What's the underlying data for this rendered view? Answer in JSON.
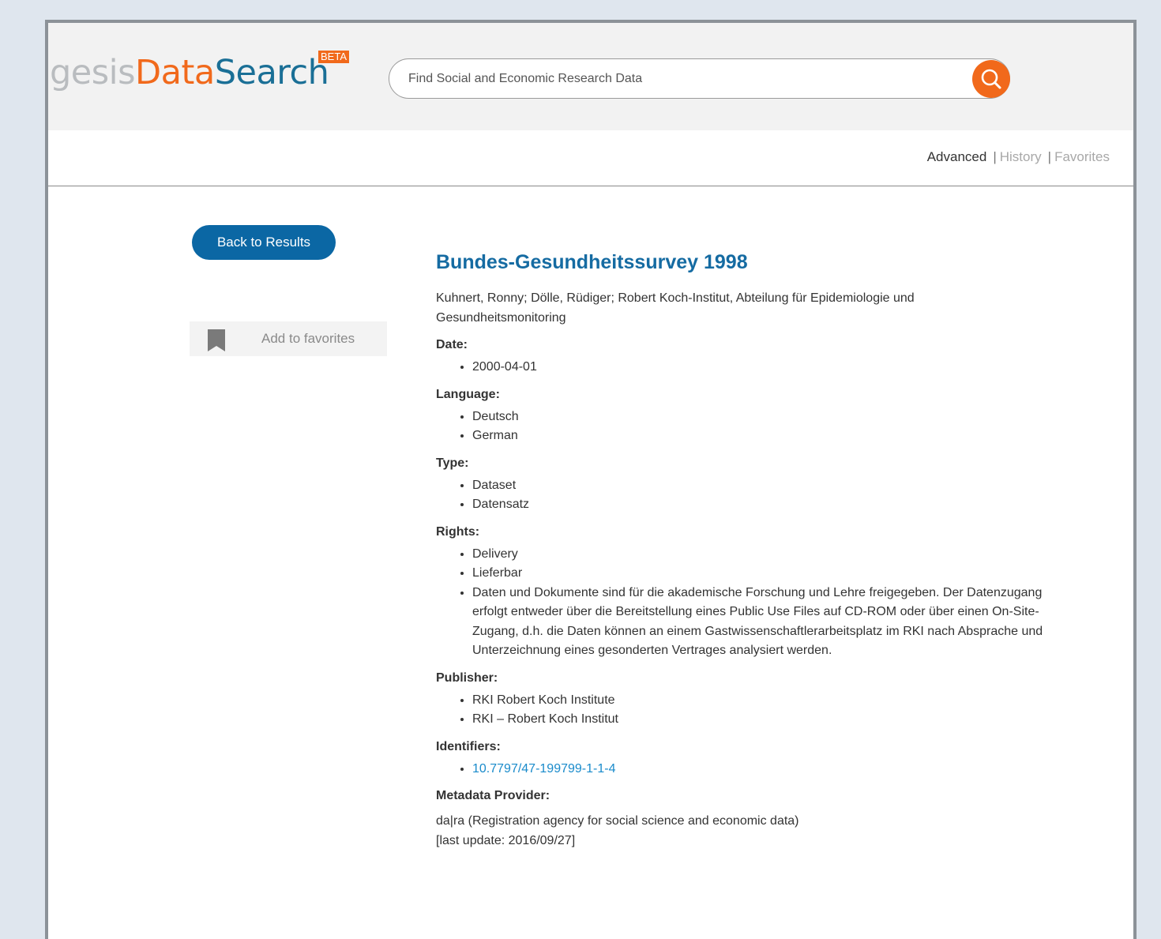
{
  "header": {
    "logo_part1": "gesis",
    "logo_part2": "Data",
    "logo_part3": "Search",
    "beta_badge": "BETA",
    "search_placeholder": "Find Social and Economic Research Data",
    "search_icon": "magnifier-icon"
  },
  "topnav": {
    "advanced": "Advanced",
    "separator": "|",
    "history": "History",
    "favorites": "Favorites"
  },
  "sidebar": {
    "back_label": "Back to Results",
    "fav_icon": "bookmark-icon",
    "fav_label": "Add to favorites"
  },
  "record": {
    "title": "Bundes-Gesundheitssurvey 1998",
    "authors_line1": "Kuhnert, Ronny; Dölle, Rüdiger; Robert Koch-Institut, Abteilung für Epidemiologie und",
    "authors_line2": "Gesundheitsmonitoring",
    "date_label": "Date:",
    "dates": [
      "2000-04-01"
    ],
    "language_label": "Language:",
    "languages": [
      "Deutsch",
      "German"
    ],
    "type_label": "Type:",
    "types": [
      "Dataset",
      "Datensatz"
    ],
    "rights_label": "Rights:",
    "rights": [
      "Delivery",
      "Lieferbar",
      "Daten und Dokumente sind für die akademische Forschung und Lehre freigegeben. Der Datenzugang erfolgt entweder über die Bereitstellung eines Public Use Files auf CD-ROM oder über einen On-Site-Zugang, d.h. die Daten können an einem Gastwissenschaftlerarbeitsplatz im RKI nach Absprache und Unterzeichnung eines gesonderten Vertrages analysiert werden."
    ],
    "publisher_label": "Publisher:",
    "publishers": [
      "RKI Robert Koch Institute",
      "RKI – Robert Koch Institut"
    ],
    "identifiers_label": "Identifiers:",
    "identifiers": [
      "10.7797/47-199799-1-1-4"
    ],
    "provider_label": "Metadata Provider:",
    "provider": "da|ra (Registration agency for social science and economic data)",
    "last_update": "[last update: 2016/09/27]"
  },
  "colors": {
    "accent_orange": "#f1691b",
    "brand_blue": "#1a6f96",
    "button_blue": "#0b67a4",
    "link_blue": "#1a8bcb"
  }
}
